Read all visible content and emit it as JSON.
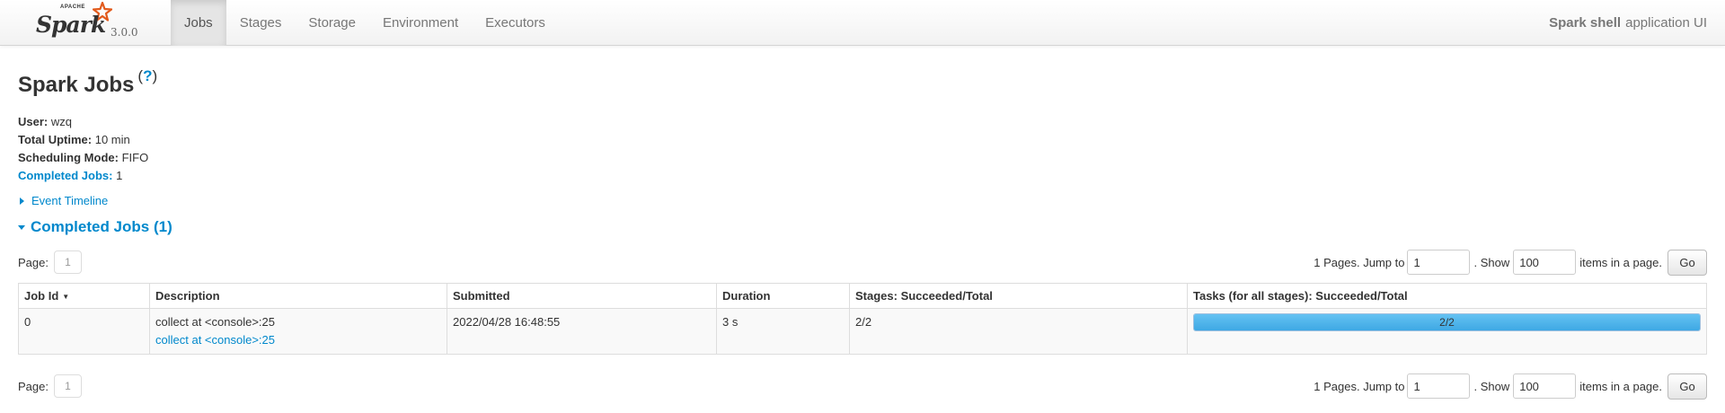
{
  "brand": {
    "apache": "APACHE",
    "name": "Spark",
    "version": "3.0.0"
  },
  "nav": {
    "tabs": [
      "Jobs",
      "Stages",
      "Storage",
      "Environment",
      "Executors"
    ],
    "active": "Jobs",
    "app_name": "Spark shell",
    "app_suffix": "application UI"
  },
  "page": {
    "title": "Spark Jobs",
    "help_open": "(",
    "help_q": "?",
    "help_close": ")"
  },
  "summary": {
    "user_label": "User:",
    "user": "wzq",
    "uptime_label": "Total Uptime:",
    "uptime": "10 min",
    "mode_label": "Scheduling Mode:",
    "mode": "FIFO",
    "completed_label": "Completed Jobs:",
    "completed": "1"
  },
  "timeline_label": "Event Timeline",
  "completed_section": "Completed Jobs (1)",
  "paging": {
    "page_label": "Page:",
    "page": "1",
    "pages_text": "1 Pages. Jump to",
    "jump_value": "1",
    "show_text": ". Show",
    "show_value": "100",
    "items_text": "items in a page.",
    "go": "Go"
  },
  "table": {
    "headers": {
      "job_id": "Job Id",
      "job_id_sort": "▼",
      "description": "Description",
      "submitted": "Submitted",
      "duration": "Duration",
      "stages": "Stages: Succeeded/Total",
      "tasks": "Tasks (for all stages): Succeeded/Total"
    },
    "rows": [
      {
        "job_id": "0",
        "desc_text": "collect at <console>:25",
        "desc_link": "collect at <console>:25",
        "submitted": "2022/04/28 16:48:55",
        "duration": "3 s",
        "stages": "2/2",
        "tasks": "2/2",
        "tasks_fraction": 1.0
      }
    ]
  },
  "colors": {
    "link": "#0088cc",
    "progress": "#3ea8e4",
    "star": "#e25a1c"
  }
}
